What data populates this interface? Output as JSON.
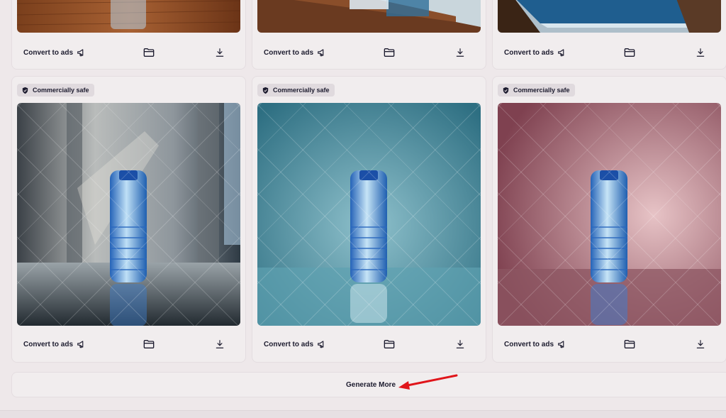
{
  "cards": [
    {
      "badge": "",
      "convert_label": "Convert to ads"
    },
    {
      "badge": "",
      "convert_label": "Convert to ads"
    },
    {
      "badge": "",
      "convert_label": "Convert to ads"
    },
    {
      "badge": "Commercially safe",
      "convert_label": "Convert to ads"
    },
    {
      "badge": "Commercially safe",
      "convert_label": "Convert to ads"
    },
    {
      "badge": "Commercially safe",
      "convert_label": "Convert to ads"
    }
  ],
  "generate_more_label": "Generate More",
  "icons": {
    "badge": "shield-check-icon",
    "convert": "megaphone-icon",
    "folder": "folder-icon",
    "download": "download-icon"
  },
  "colors": {
    "annotation_arrow": "#e0151a",
    "page_bg": "#eee8ea",
    "card_bg": "#f1edee"
  }
}
